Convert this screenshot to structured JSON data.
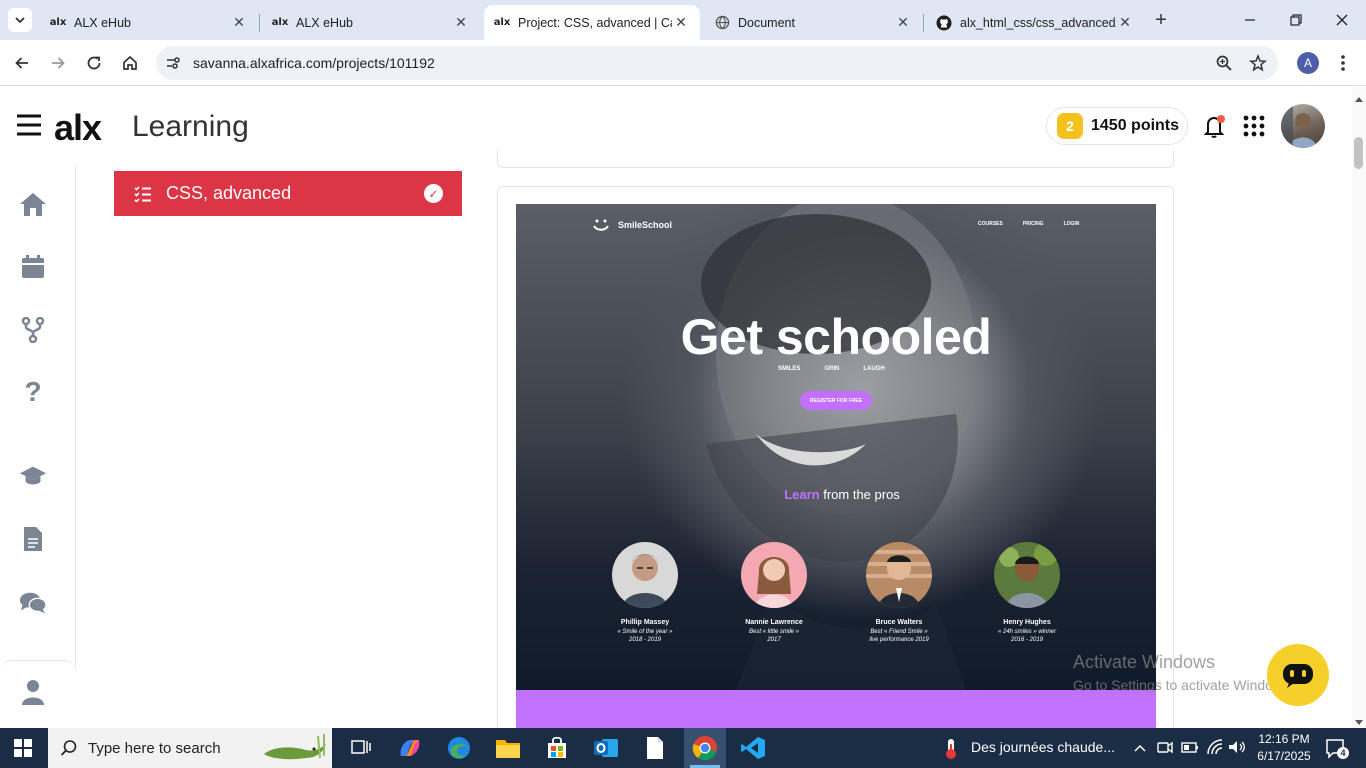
{
  "browser": {
    "tabs": [
      {
        "label": "ALX eHub",
        "favicon": "alx-favicon",
        "active": false
      },
      {
        "label": "ALX eHub",
        "favicon": "alx-favicon",
        "active": false
      },
      {
        "label": "Project: CSS, advanced | Cas",
        "favicon": "alx-favicon",
        "active": true
      },
      {
        "label": "Document",
        "favicon": "globe-icon",
        "active": false
      },
      {
        "label": "alx_html_css/css_advanced/s",
        "favicon": "github-icon",
        "active": false
      }
    ],
    "url": "savanna.alxafrica.com/projects/101192",
    "profile_initial": "A",
    "alx_favicon_text": "alx"
  },
  "header": {
    "logo_text": "alx",
    "logo_subtitle": "Learning",
    "points_label": "1450 points",
    "coin_glyph": "2"
  },
  "sidebar": {
    "project_label": "CSS, advanced"
  },
  "mockup": {
    "brand_name": "SmileSchool",
    "nav": [
      "COURSES",
      "PRICING",
      "LOGIN"
    ],
    "hero_title": "Get schooled",
    "hero_subtitles": [
      "SMILES",
      "GRIN",
      "LAUGH"
    ],
    "register_label": "REGISTER FOR FREE",
    "learn_highlight": "Learn",
    "learn_rest": "from the pros",
    "quotes": [
      {
        "name": "Phillip Massey",
        "title": "« Smile of the year »",
        "year": "2018 - 2019"
      },
      {
        "name": "Nannie Lawrence",
        "title": "Best « little smile »",
        "year": "2017"
      },
      {
        "name": "Bruce Walters",
        "title": "Best « Friend Smile »",
        "year": "live performance 2019"
      },
      {
        "name": "Henry Hughes",
        "title": "« 24h smiles » winner",
        "year": "2016 - 2019"
      }
    ]
  },
  "watermark": {
    "line1": "Activate Windows",
    "line2": "Go to Settings to activate Windows."
  },
  "taskbar": {
    "search_placeholder": "Type here to search",
    "weather_text": "Des journées chaude...",
    "time": "12:16 PM",
    "date": "6/17/2025",
    "notification_count": "4"
  },
  "colors": {
    "alx_red": "#dc3545",
    "accent_purple": "#c271ff",
    "coin_yellow": "#f4c21c",
    "chat_yellow": "#f5cf2a",
    "taskbar_bg": "#1b2d44"
  }
}
